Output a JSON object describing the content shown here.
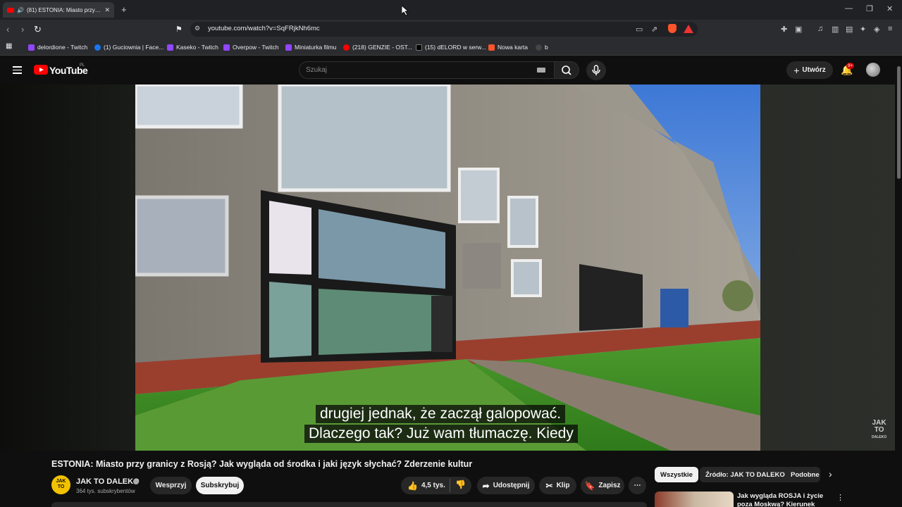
{
  "browser": {
    "tab_title": "(81) ESTONIA: Miasto przy granicy z Rosją?",
    "url": "youtube.com/watch?v=SqFRjkNh6mc",
    "bookmarks": [
      {
        "label": "delordione - Twitch",
        "color": "#9146ff"
      },
      {
        "label": "(1) Guciownia | Face...",
        "color": "#1877f2"
      },
      {
        "label": "Kaseko - Twitch",
        "color": "#9146ff"
      },
      {
        "label": "Overpow - Twitch",
        "color": "#9146ff"
      },
      {
        "label": "Miniaturka filmu",
        "color": "#9146ff"
      },
      {
        "label": "(218) GENZIE - OST...",
        "color": "#ff0000"
      },
      {
        "label": "(15) dELORD w serw...",
        "color": "#000000"
      },
      {
        "label": "Nowa karta",
        "color": "#fb542b"
      },
      {
        "label": "b",
        "color": "#444444"
      }
    ]
  },
  "youtube": {
    "logo_text": "YouTube",
    "region": "PL",
    "search_placeholder": "Szukaj",
    "create_label": "Utwórz",
    "notification_badge": "9+"
  },
  "video": {
    "subtitle_line1": "drugiej jednak, że zaczął galopować.",
    "subtitle_line2": "Dlaczego tak? Już wam tłumaczę. Kiedy",
    "watermark_line1": "JAK",
    "watermark_line2": "TO",
    "watermark_line3": "DALEKO",
    "title": "ESTONIA: Miasto przy granicy z Rosją? Jak wygląda od środka i jaki język słychać? Zderzenie kultur"
  },
  "channel": {
    "logo_line1": "JAK",
    "logo_line2": "TO",
    "name": "JAK TO DALEKO",
    "subscribers": "364 tys. subskrybentów",
    "support_label": "Wesprzyj",
    "subscribe_label": "Subskrybuj"
  },
  "actions": {
    "likes": "4,5 tys.",
    "share_label": "Udostępnij",
    "clip_label": "Klip",
    "save_label": "Zapisz"
  },
  "recommendations": {
    "chips": [
      "Wszystkie",
      "Źródło: JAK TO DALEKO",
      "Podobne"
    ],
    "first_title": "Jak wygląda ROSJA i życie poza Moskwą? Kierunek miasto Tver"
  }
}
